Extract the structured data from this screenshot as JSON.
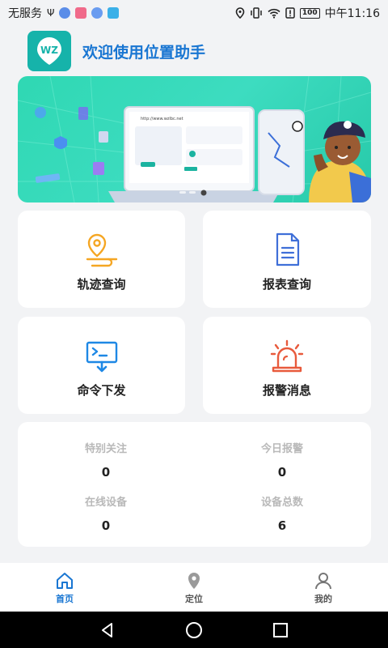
{
  "status_bar": {
    "carrier": "无服务",
    "battery": "100",
    "time": "中午11:16"
  },
  "header": {
    "logo_text": "WZ",
    "title": "欢迎使用位置助手"
  },
  "banner": {
    "screen_url": "http://www.wzlbc.net"
  },
  "cards": [
    {
      "label": "轨迹查询",
      "icon": "location-track-icon",
      "color": "#f5a623"
    },
    {
      "label": "报表查询",
      "icon": "report-document-icon",
      "color": "#3f6fd8"
    },
    {
      "label": "命令下发",
      "icon": "command-send-icon",
      "color": "#1e88e5"
    },
    {
      "label": "报警消息",
      "icon": "alarm-siren-icon",
      "color": "#e85a3c"
    }
  ],
  "stats": [
    {
      "label": "特别关注",
      "value": "0"
    },
    {
      "label": "今日报警",
      "value": "0"
    },
    {
      "label": "在线设备",
      "value": "0"
    },
    {
      "label": "设备总数",
      "value": "6"
    }
  ],
  "bottom_nav": [
    {
      "label": "首页",
      "icon": "home-icon",
      "active": true
    },
    {
      "label": "定位",
      "icon": "location-pin-icon",
      "active": false
    },
    {
      "label": "我的",
      "icon": "profile-icon",
      "active": false
    }
  ],
  "colors": {
    "accent": "#1976d2",
    "logo": "#16b3aa",
    "banner": "#2fd8b3",
    "background": "#f2f3f5"
  }
}
